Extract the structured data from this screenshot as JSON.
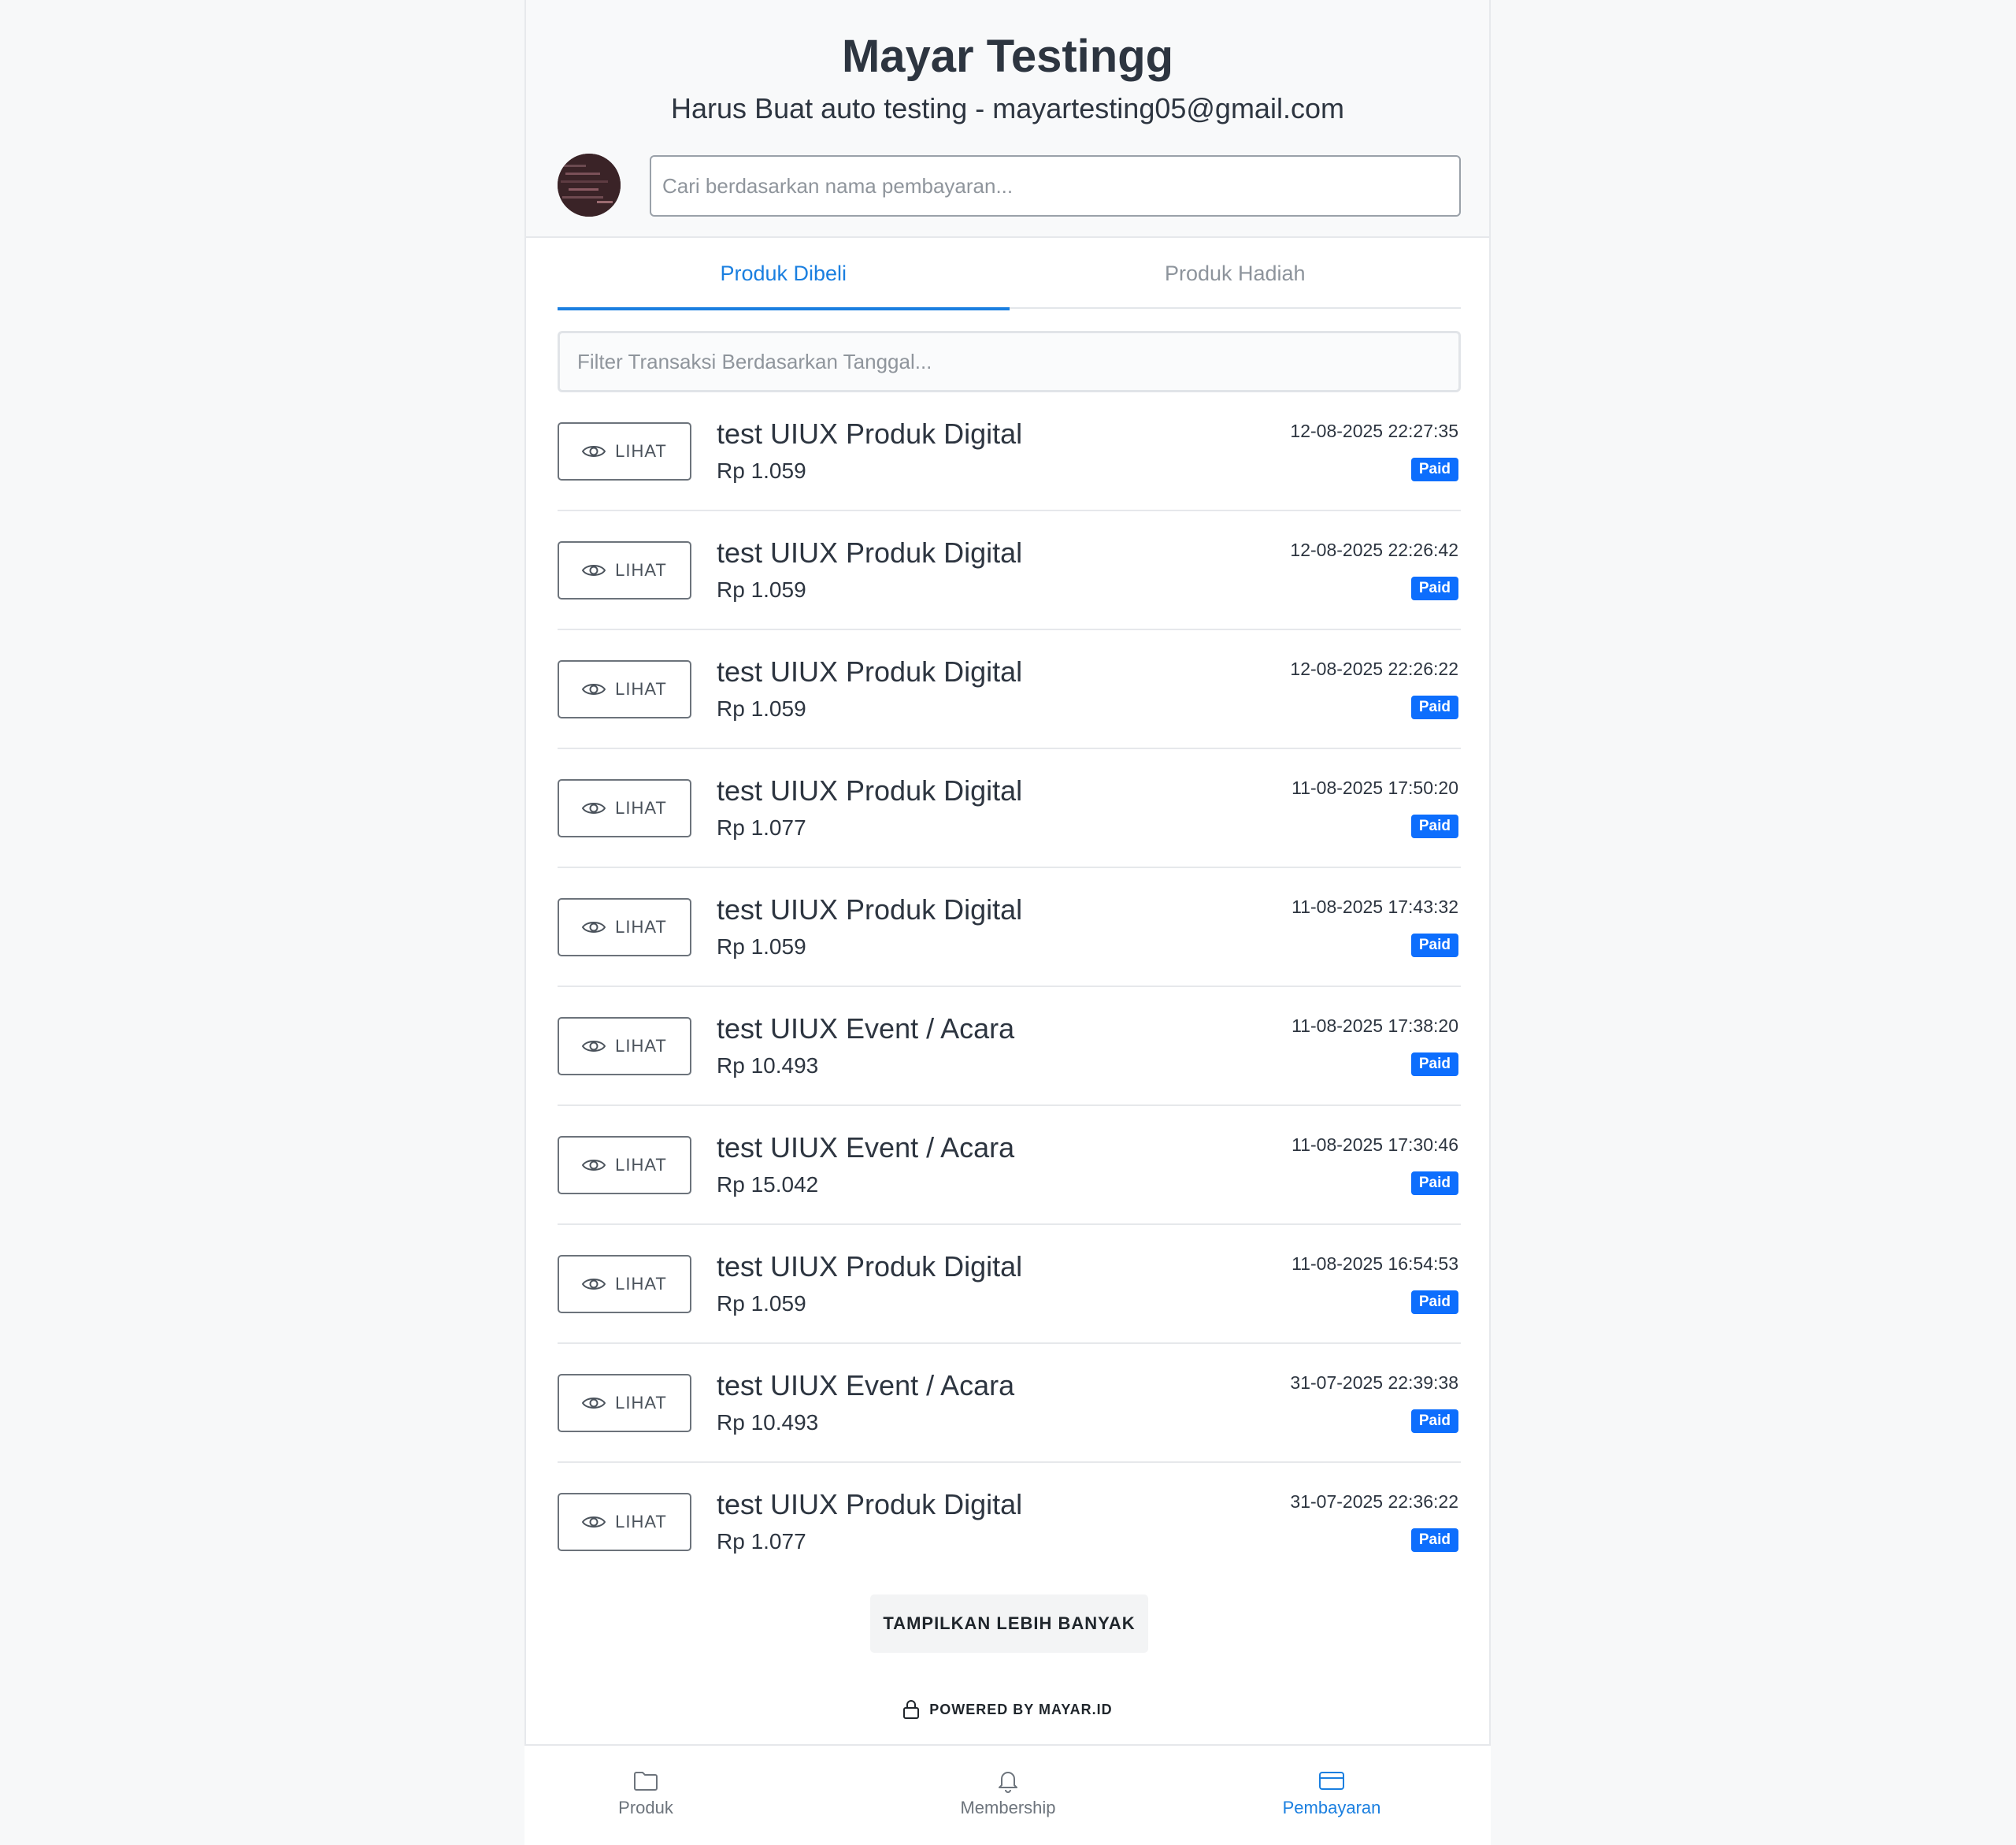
{
  "header": {
    "store_name": "Mayar Testingg",
    "account_line": "Harus Buat auto testing - mayartesting05@gmail.com",
    "search_placeholder": "Cari berdasarkan nama pembayaran..."
  },
  "tabs": [
    {
      "label": "Produk Dibeli",
      "active": true
    },
    {
      "label": "Produk Hadiah",
      "active": false
    }
  ],
  "filter": {
    "placeholder": "Filter Transaksi Berdasarkan Tanggal..."
  },
  "view_button_label": "LIHAT",
  "transactions": [
    {
      "name": "test UIUX Produk Digital",
      "price": "Rp 1.059",
      "datetime": "12-08-2025 22:27:35",
      "status": "Paid"
    },
    {
      "name": "test UIUX Produk Digital",
      "price": "Rp 1.059",
      "datetime": "12-08-2025 22:26:42",
      "status": "Paid"
    },
    {
      "name": "test UIUX Produk Digital",
      "price": "Rp 1.059",
      "datetime": "12-08-2025 22:26:22",
      "status": "Paid"
    },
    {
      "name": "test UIUX Produk Digital",
      "price": "Rp 1.077",
      "datetime": "11-08-2025 17:50:20",
      "status": "Paid"
    },
    {
      "name": "test UIUX Produk Digital",
      "price": "Rp 1.059",
      "datetime": "11-08-2025 17:43:32",
      "status": "Paid"
    },
    {
      "name": "test UIUX Event / Acara",
      "price": "Rp 10.493",
      "datetime": "11-08-2025 17:38:20",
      "status": "Paid"
    },
    {
      "name": "test UIUX Event / Acara",
      "price": "Rp 15.042",
      "datetime": "11-08-2025 17:30:46",
      "status": "Paid"
    },
    {
      "name": "test UIUX Produk Digital",
      "price": "Rp 1.059",
      "datetime": "11-08-2025 16:54:53",
      "status": "Paid"
    },
    {
      "name": "test UIUX Event / Acara",
      "price": "Rp 10.493",
      "datetime": "31-07-2025 22:39:38",
      "status": "Paid"
    },
    {
      "name": "test UIUX Produk Digital",
      "price": "Rp 1.077",
      "datetime": "31-07-2025 22:36:22",
      "status": "Paid"
    }
  ],
  "load_more_label": "TAMPILKAN LEBIH BANYAK",
  "powered_by": "POWERED BY MAYAR.ID",
  "bottom_nav": [
    {
      "label": "Produk",
      "icon": "folder-icon",
      "active": false
    },
    {
      "label": "Membership",
      "icon": "bell-icon",
      "active": false
    },
    {
      "label": "Pembayaran",
      "icon": "credit-card-icon",
      "active": true
    }
  ],
  "colors": {
    "accent": "#1a7fe0",
    "badge": "#0d6efd"
  }
}
